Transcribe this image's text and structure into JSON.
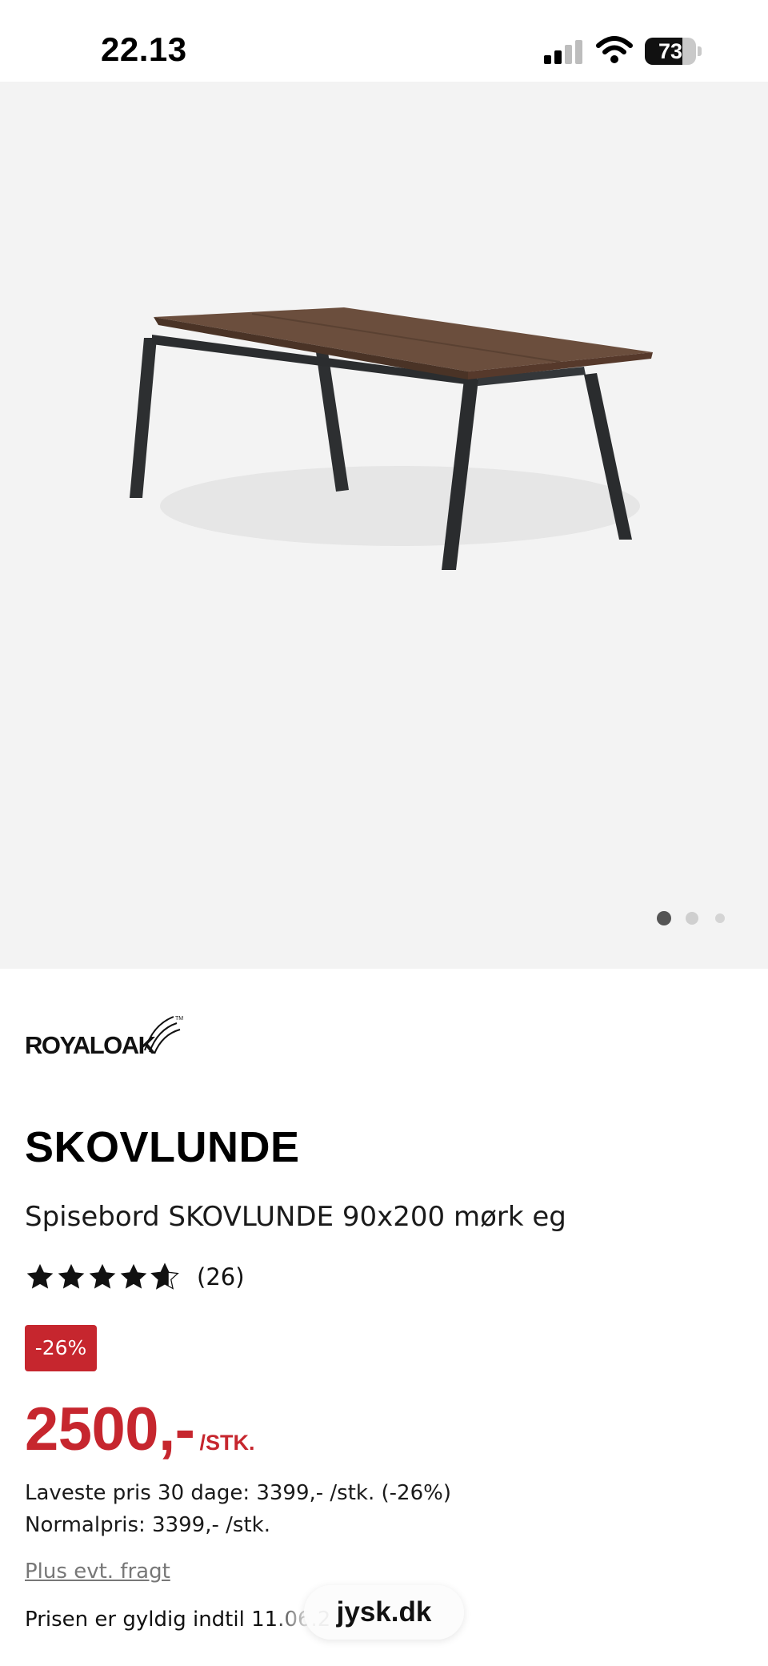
{
  "status_bar": {
    "time": "22.13",
    "battery_level": "73",
    "signal_bars_active": 2,
    "signal_bars_total": 4
  },
  "gallery": {
    "image_count": 3,
    "active_index": 0,
    "image_subject": "table-image"
  },
  "product": {
    "brand": "ROYALOAK",
    "name": "SKOVLUNDE",
    "description": "Spisebord SKOVLUNDE 90x200 mørk eg",
    "rating": 4.6,
    "rating_max": 5,
    "review_count": "(26)",
    "discount_badge": "-26%",
    "price": "2500,-",
    "price_unit": "/STK.",
    "lowest_price_30_days": "Laveste pris 30 dage: 3399,- /stk. (-26%)",
    "normal_price": "Normalpris: 3399,- /stk.",
    "shipping_link": "Plus evt. fragt",
    "price_validity": "Prisen er gyldig indtil 11.06.2"
  },
  "browser": {
    "url": "jysk.dk"
  },
  "colors": {
    "accent_red": "#c6262e",
    "gallery_bg": "#f3f3f3",
    "text_dark": "#111111"
  }
}
